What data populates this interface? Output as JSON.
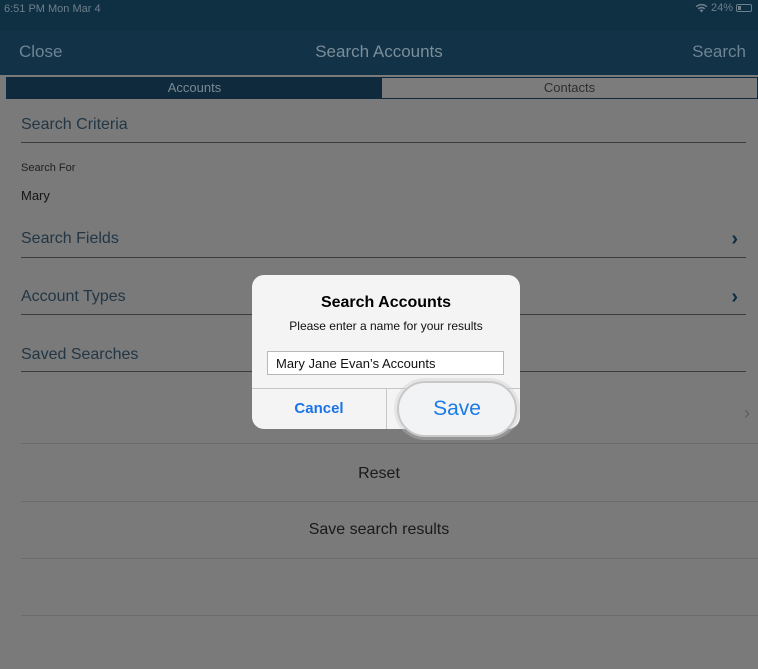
{
  "status": {
    "time": "6:51 PM  Mon Mar 4",
    "battery": "24%",
    "battery_level": 0.24
  },
  "nav": {
    "left": "Close",
    "title": "Search Accounts",
    "right": "Search"
  },
  "tabs": [
    {
      "label": "Accounts",
      "selected": true
    },
    {
      "label": "Contacts",
      "selected": false
    }
  ],
  "form": {
    "search_criteria": "Search Criteria",
    "search_for_label": "Search For",
    "search_for_value": "Mary",
    "search_fields": "Search Fields",
    "account_types": "Account Types",
    "saved_searches": "Saved Searches",
    "reset": "Reset",
    "save_results": "Save search results"
  },
  "alert": {
    "title": "Search Accounts",
    "message": "Please enter a name for your results",
    "input_value": "Mary Jane Evan’s Accounts",
    "cancel": "Cancel",
    "save": "Save"
  },
  "colors": {
    "nav_bg": "#113247",
    "accent": "#1a73e8",
    "dim_bg": "#7a7a7a"
  }
}
